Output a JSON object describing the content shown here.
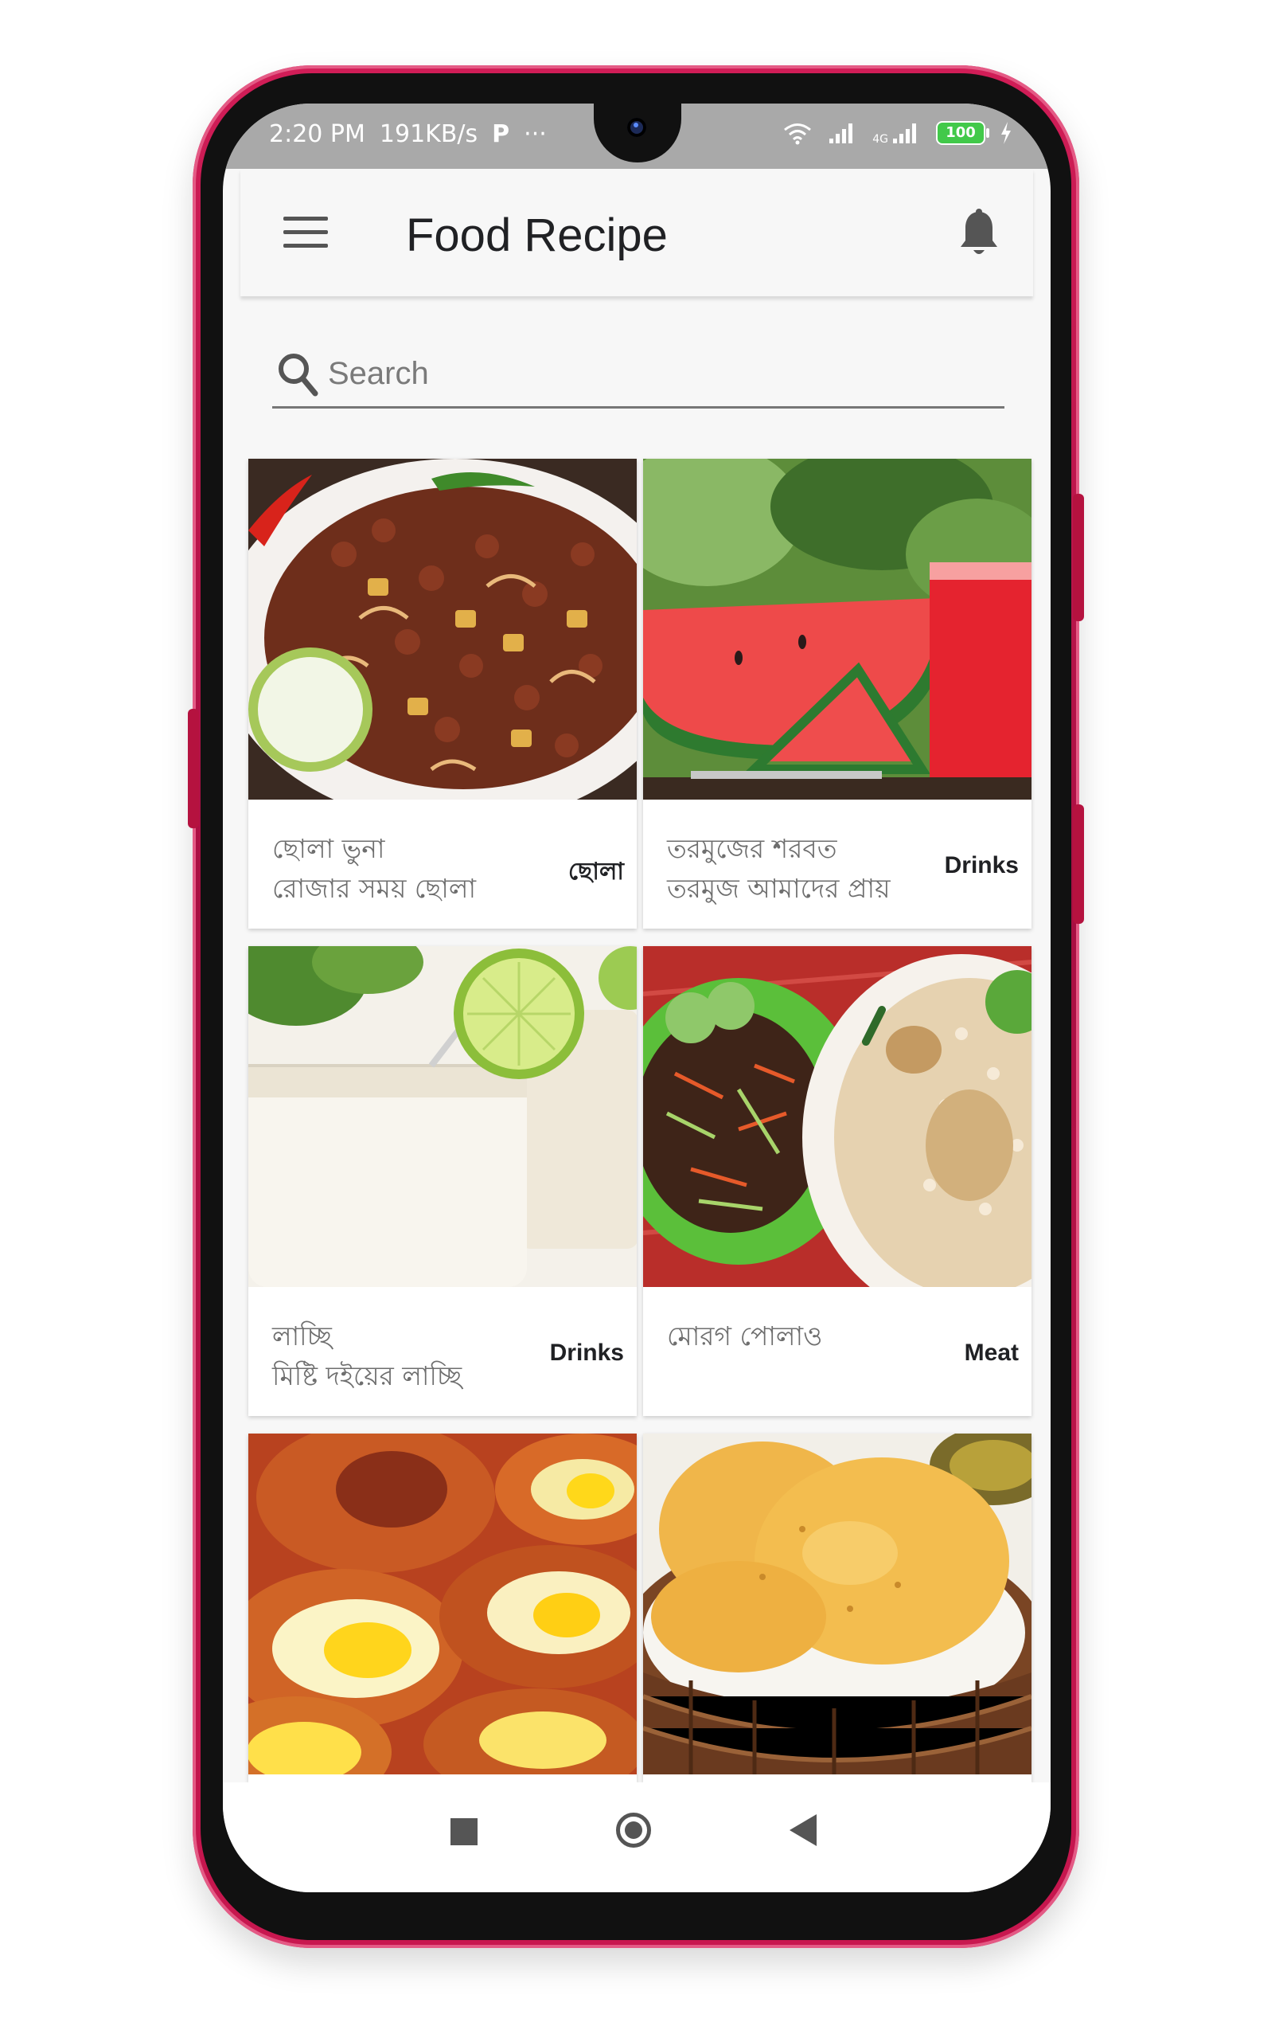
{
  "status_bar": {
    "time": "2:20 PM",
    "speed": "191KB/s",
    "p_glyph": "P",
    "more": "···",
    "network_small": "4G",
    "battery": "100"
  },
  "app_bar": {
    "title": "Food Recipe",
    "menu_icon": "hamburger-menu",
    "notify_icon": "bell"
  },
  "search": {
    "placeholder": "Search",
    "value": ""
  },
  "recipes": [
    {
      "title": "ছোলা ভুনা",
      "subtitle": "রোজার সময় ছোলা",
      "category": "ছোলা",
      "image_icon": "chickpea-dish"
    },
    {
      "title": "তরমুজের শরবত",
      "subtitle": "তরমুজ আমাদের প্রায়",
      "category": "Drinks",
      "image_icon": "watermelon-juice"
    },
    {
      "title": "লাচ্ছি",
      "subtitle": "মিষ্টি দইয়ের লাচ্ছি",
      "category": "Drinks",
      "image_icon": "lassi-glasses"
    },
    {
      "title": "মোরগ পোলাও",
      "subtitle": "",
      "category": "Meat",
      "image_icon": "morog-polao"
    },
    {
      "title": "",
      "subtitle": "",
      "category": "",
      "image_icon": "egg-chop"
    },
    {
      "title": "",
      "subtitle": "",
      "category": "",
      "image_icon": "puri-basket"
    }
  ],
  "nav_bar": {
    "recents_icon": "square",
    "home_icon": "circle",
    "back_icon": "triangle-left"
  },
  "colors": {
    "frame": "#c8174f",
    "bezel": "#111111",
    "status_bg": "#a9a9a9",
    "app_bg": "#f7f7f7",
    "card_bg": "#ffffff",
    "text_dark": "#202124",
    "text_grey": "#6e6e6e",
    "battery": "#42c94a"
  }
}
